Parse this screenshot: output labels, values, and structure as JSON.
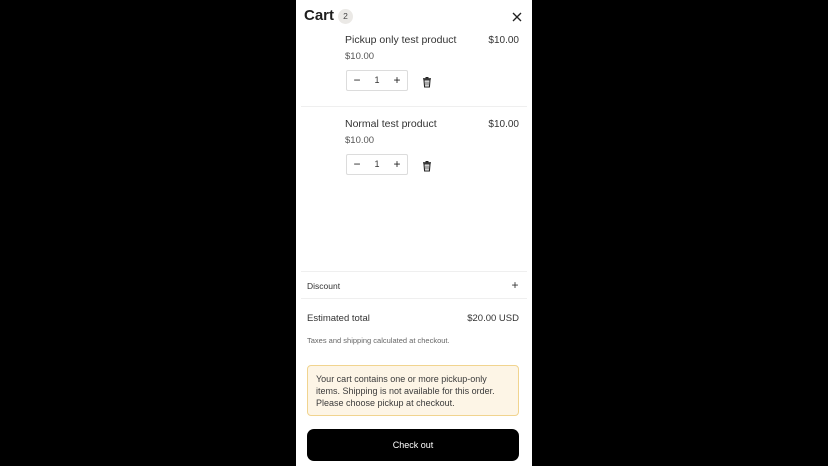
{
  "header": {
    "title": "Cart",
    "count": "2",
    "close_icon": "close-icon"
  },
  "items": [
    {
      "name": "Pickup only test product",
      "line_price": "$10.00",
      "unit_price": "$10.00",
      "quantity": "1",
      "minus": "−",
      "plus": "+",
      "remove_icon": "trash-icon"
    },
    {
      "name": "Normal test product",
      "line_price": "$10.00",
      "unit_price": "$10.00",
      "quantity": "1",
      "minus": "−",
      "plus": "+",
      "remove_icon": "trash-icon"
    }
  ],
  "discount": {
    "label": "Discount",
    "toggle": "+"
  },
  "summary": {
    "total_label": "Estimated total",
    "total_value": "$20.00 USD",
    "tax_note": "Taxes and shipping calculated at checkout."
  },
  "notice": {
    "text": "Your cart contains one or more pickup-only items. Shipping is not available for this order. Please choose pickup at checkout."
  },
  "checkout": {
    "label": "Check out"
  },
  "colors": {
    "backdrop": "#000000",
    "drawer": "#ffffff",
    "notice_bg": "#fdf5e6",
    "notice_border": "#f1d48f",
    "checkout_bg": "#000000"
  }
}
